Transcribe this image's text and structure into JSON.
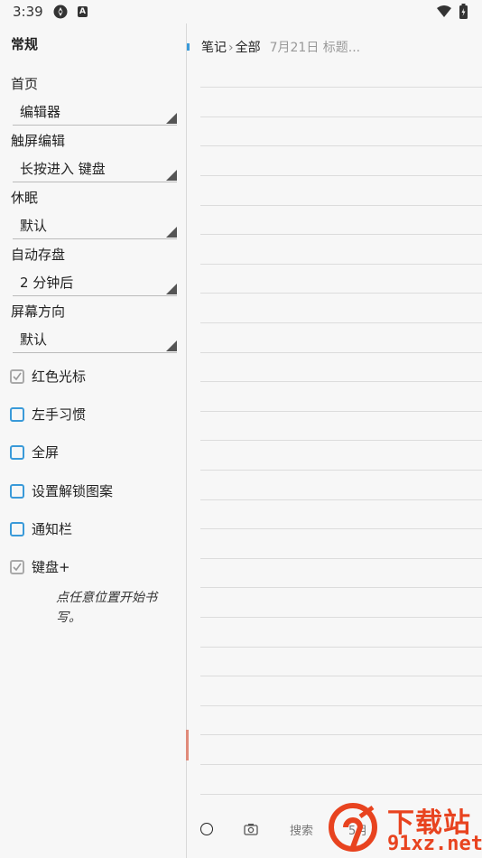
{
  "status_bar": {
    "time": "3:39",
    "icons": [
      "app-icon",
      "a-icon",
      "wifi-icon",
      "battery-charging-icon"
    ]
  },
  "sidebar": {
    "title": "常规",
    "settings": [
      {
        "label": "首页",
        "value": "编辑器"
      },
      {
        "label": "触屏编辑",
        "value": "长按进入 键盘"
      },
      {
        "label": "休眠",
        "value": "默认"
      },
      {
        "label": "自动存盘",
        "value": "2 分钟后"
      },
      {
        "label": "屏幕方向",
        "value": "默认"
      }
    ],
    "checkboxes": [
      {
        "label": "红色光标",
        "checked": true
      },
      {
        "label": "左手习惯",
        "checked": false
      },
      {
        "label": "全屏",
        "checked": false
      },
      {
        "label": "设置解锁图案",
        "checked": false
      },
      {
        "label": "通知栏",
        "checked": false
      },
      {
        "label": "键盘+",
        "checked": true
      }
    ],
    "hint": "点任意位置开始书写。"
  },
  "main": {
    "breadcrumb": {
      "root": "笔记",
      "folder": "全部",
      "meta": "7月21日 标题..."
    },
    "bottom_bar": {
      "search": "搜索",
      "extra": "5月"
    }
  },
  "watermark": {
    "title": "下载站",
    "domain": "91xz.net"
  },
  "colors": {
    "accent": "#3a9ad9",
    "watermark": "#e8431f",
    "background": "#f7f7f7"
  }
}
